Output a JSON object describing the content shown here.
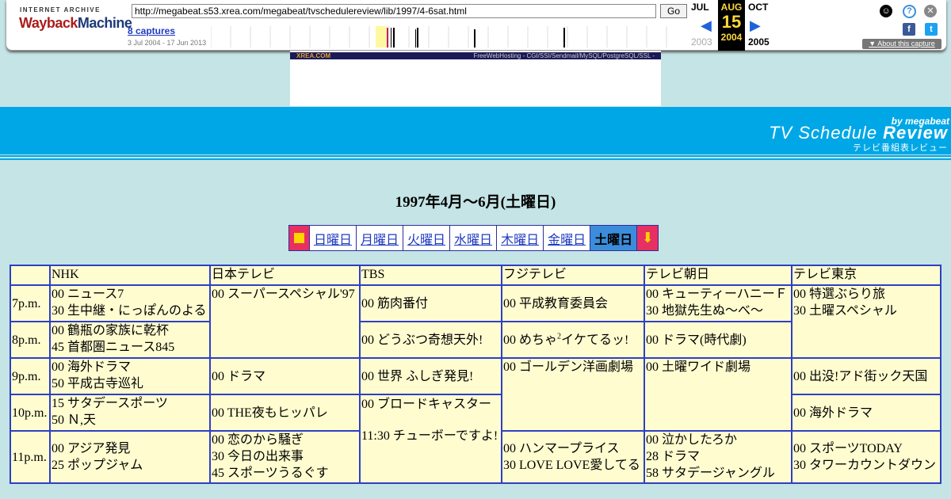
{
  "wayback": {
    "logo_top": "INTERNET ARCHIVE",
    "logo_word1": "Wayback",
    "logo_word2": "Machine",
    "url": "http://megabeat.s53.xrea.com/megabeat/tvschedulereview/lib/1997/4-6sat.html",
    "go_label": "Go",
    "captures": "8 captures",
    "range": "3 Jul 2004 - 17 Jun 2013",
    "prev_month": "JUL",
    "cur_month": "AUG",
    "next_month": "OCT",
    "cur_day": "15",
    "prev_year": "2003",
    "cur_year": "2004",
    "next_year": "2005",
    "about": "About this capture"
  },
  "ad": {
    "left_text": "XREA.COM",
    "right_text": "FreeWebHosting - CGI/SSI/Sendmail/MySQL/PostgreSQL/SSL -"
  },
  "header": {
    "by": "by megabeat",
    "title_a": "TV Schedule ",
    "title_b": "Review",
    "jp": "テレビ番組表レビュー"
  },
  "page_title": "1997年4月～6月(土曜日)",
  "daynav": {
    "days": [
      "日曜日",
      "月曜日",
      "火曜日",
      "水曜日",
      "木曜日",
      "金曜日"
    ],
    "current": "土曜日"
  },
  "schedule": {
    "channels": [
      "NHK",
      "日本テレビ",
      "TBS",
      "フジテレビ",
      "テレビ朝日",
      "テレビ東京"
    ],
    "times": [
      "7p.m.",
      "8p.m.",
      "9p.m.",
      "10p.m.",
      "11p.m."
    ],
    "nhk": {
      "p7a": "00 ニュース7",
      "p7b": "30 生中継・にっぽんのよる",
      "p8a": "00 鶴瓶の家族に乾杯",
      "p8b": "45 首都圏ニュース845",
      "p9a": "00 海外ドラマ",
      "p9b": "50 平成古寺巡礼",
      "p10a": "15 サタデースポーツ",
      "p10b": "50 Ｎ,天",
      "p11a": "00 アジア発見",
      "p11b": "25 ポップジャム"
    },
    "ntv": {
      "p7": "00 スーパースペシャル'97",
      "p9": "00 ドラマ",
      "p10": "00 THE夜もヒッパレ",
      "p11a": "00 恋のから騒ぎ",
      "p11b": "30 今日の出来事",
      "p11c": "45 スポーツうるぐす"
    },
    "tbs": {
      "p7": "00 筋肉番付",
      "p8": "00 どうぶつ奇想天外!",
      "p9": "00 世界 ふしぎ発見!",
      "p10a": "00 ブロードキャスター",
      "p10b": "11:30 チューボーですよ!"
    },
    "fuji": {
      "p7": "00 平成教育委員会",
      "p8a": "00 めちゃ",
      "p8sup": "2",
      "p8b": "イケてるッ!",
      "p9": "00 ゴールデン洋画劇場",
      "p11a": "00 ハンマープライス",
      "p11b": "30 LOVE LOVE愛してる"
    },
    "asahi": {
      "p7a": "00 キューティーハニーＦ",
      "p7b": "30 地獄先生ぬ～べ～",
      "p8": "00 ドラマ(時代劇)",
      "p9": "00 土曜ワイド劇場",
      "p11a": "00 泣かしたろか",
      "p11b": "28 ドラマ",
      "p11c": "58 サタデージャングル"
    },
    "tx": {
      "p7a": "00 特選ぶらり旅",
      "p7b": "30 土曜スペシャル",
      "p9": "00 出没!アド街ック天国",
      "p10": "00 海外ドラマ",
      "p11a": "00 スポーツTODAY",
      "p11b": "30 タワーカウントダウン"
    }
  }
}
